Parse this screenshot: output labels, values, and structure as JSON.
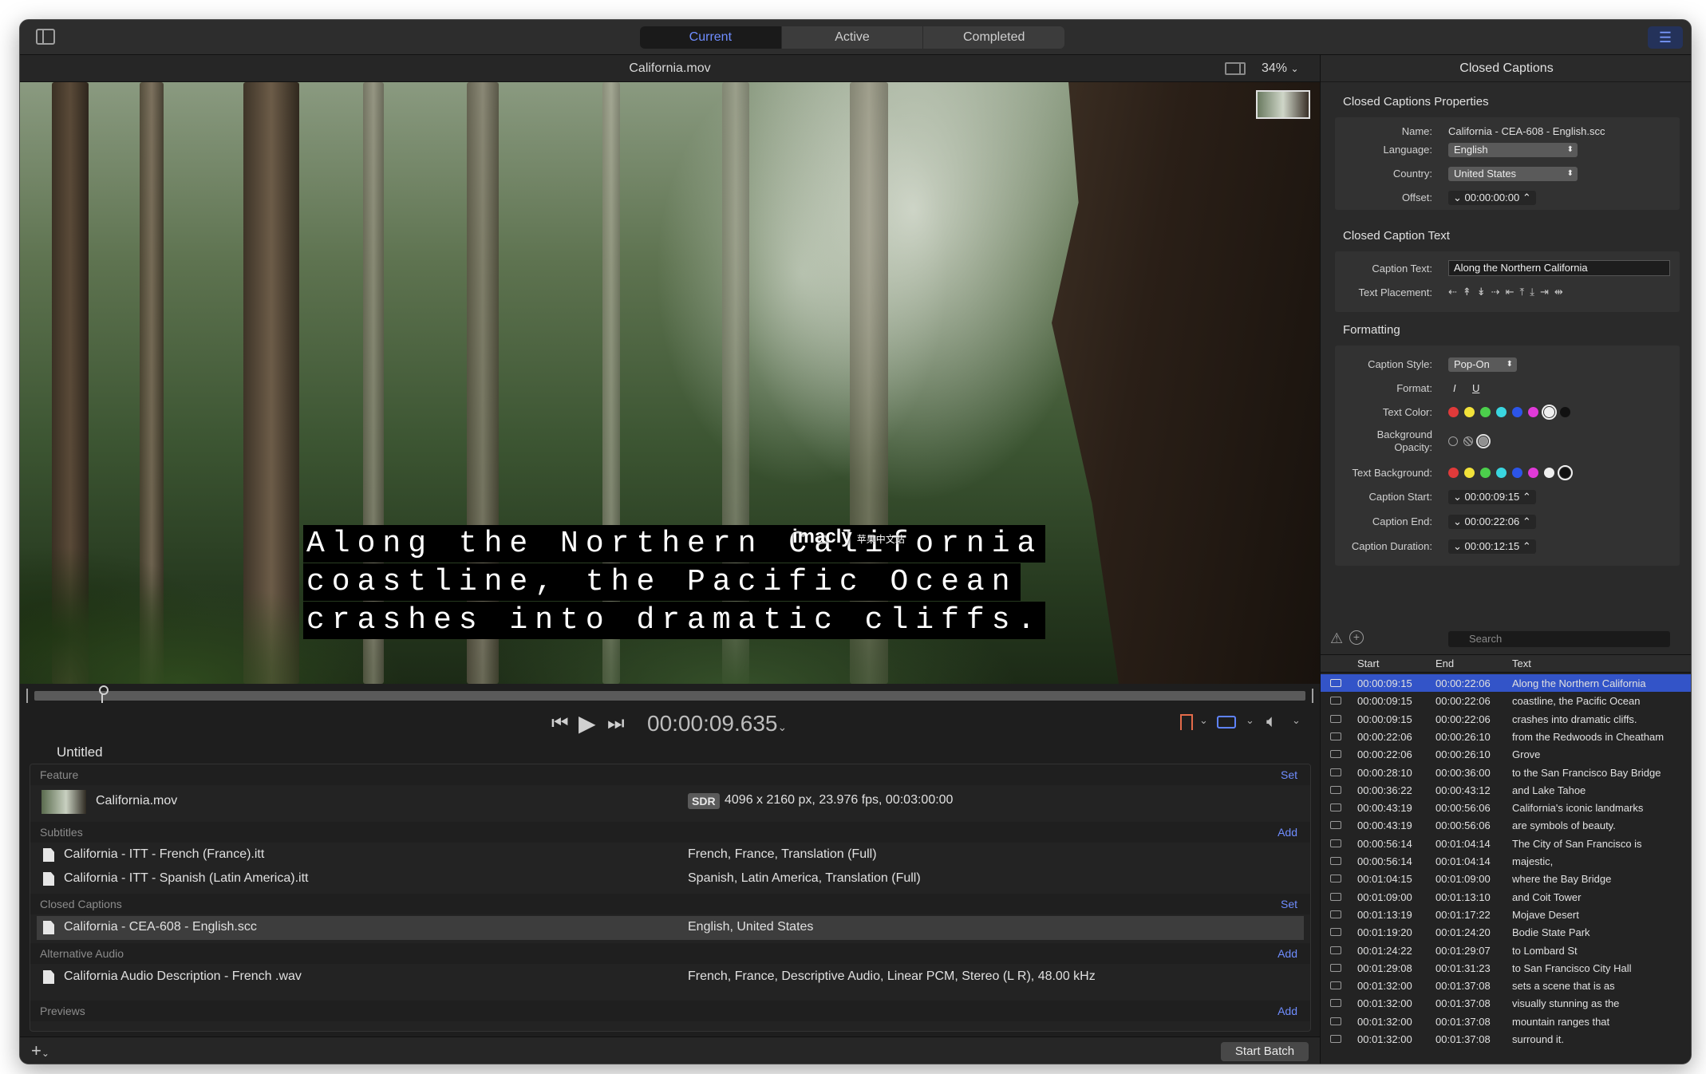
{
  "toolbar": {
    "tabs": [
      "Current",
      "Active",
      "Completed"
    ],
    "selected_tab": "Current",
    "accent": "#6f8dff"
  },
  "viewer": {
    "file_title": "California.mov",
    "zoom": "34%",
    "caption_lines": [
      "Along the Northern California",
      "coastline, the Pacific Ocean",
      "crashes into dramatic cliffs."
    ],
    "watermark": "imacly",
    "watermark_sub": "苹果中文站",
    "timecode": "00:00:09.635",
    "playhead_fraction": 0.053
  },
  "batch": {
    "title": "Untitled",
    "feature": {
      "label": "Feature",
      "action": "Set",
      "file": "California.mov",
      "badge": "SDR",
      "info": "4096 x 2160 px, 23.976 fps, 00:03:00:00"
    },
    "subtitles": {
      "label": "Subtitles",
      "action": "Add",
      "items": [
        {
          "name": "California - ITT - French (France).itt",
          "info": "French, France, Translation (Full)"
        },
        {
          "name": "California - ITT - Spanish (Latin America).itt",
          "info": "Spanish, Latin America, Translation (Full)"
        }
      ]
    },
    "closed_captions": {
      "label": "Closed Captions",
      "action": "Set",
      "items": [
        {
          "name": "California - CEA-608 - English.scc",
          "info": "English, United States"
        }
      ]
    },
    "alt_audio": {
      "label": "Alternative Audio",
      "action": "Add",
      "items": [
        {
          "name": "California Audio Description - French .wav",
          "info": "French, France, Descriptive Audio, Linear PCM, Stereo (L R), 48.00 kHz"
        }
      ]
    },
    "previews": {
      "label": "Previews",
      "action": "Add"
    },
    "start_label": "Start Batch"
  },
  "inspector": {
    "title": "Closed Captions",
    "props_title": "Closed Captions Properties",
    "name_label": "Name:",
    "name_value": "California - CEA-608 - English.scc",
    "language_label": "Language:",
    "language_value": "English",
    "country_label": "Country:",
    "country_value": "United States",
    "offset_label": "Offset:",
    "offset_value": "00:00:00:00",
    "text_title": "Closed Caption Text",
    "caption_text_label": "Caption Text:",
    "caption_text_value": "Along the Northern California",
    "placement_label": "Text Placement:",
    "placement_glyphs": "⇠↟↡⇢⇤⤒⤓⇥⇹",
    "formatting_title": "Formatting",
    "style_label": "Caption Style:",
    "style_value": "Pop-On",
    "format_label": "Format:",
    "format_italic": "I",
    "format_underline": "U",
    "text_color_label": "Text Color:",
    "bg_opacity_label_1": "Background",
    "bg_opacity_label_2": "Opacity:",
    "text_bg_label": "Text Background:",
    "start_label": "Caption Start:",
    "start_value": "00:00:09:15",
    "end_label": "Caption End:",
    "end_value": "00:00:22:06",
    "duration_label": "Caption Duration:",
    "duration_value": "00:00:12:15",
    "colors": [
      "#e03a3a",
      "#f2e23a",
      "#4ccf4c",
      "#3ad6e0",
      "#2c55e8",
      "#e03ad8",
      "#f0f0f0",
      "#111111"
    ]
  },
  "caption_list": {
    "search_placeholder": "Search",
    "headers": {
      "start": "Start",
      "end": "End",
      "text": "Text"
    },
    "rows": [
      {
        "start": "00:00:09:15",
        "end": "00:00:22:06",
        "text": "Along the Northern California"
      },
      {
        "start": "00:00:09:15",
        "end": "00:00:22:06",
        "text": "coastline, the Pacific Ocean"
      },
      {
        "start": "00:00:09:15",
        "end": "00:00:22:06",
        "text": "crashes into dramatic cliffs."
      },
      {
        "start": "00:00:22:06",
        "end": "00:00:26:10",
        "text": "from the Redwoods in Cheatham"
      },
      {
        "start": "00:00:22:06",
        "end": "00:00:26:10",
        "text": "Grove"
      },
      {
        "start": "00:00:28:10",
        "end": "00:00:36:00",
        "text": "to the San Francisco Bay Bridge"
      },
      {
        "start": "00:00:36:22",
        "end": "00:00:43:12",
        "text": "and Lake Tahoe"
      },
      {
        "start": "00:00:43:19",
        "end": "00:00:56:06",
        "text": "California's iconic landmarks"
      },
      {
        "start": "00:00:43:19",
        "end": "00:00:56:06",
        "text": "are symbols of beauty."
      },
      {
        "start": "00:00:56:14",
        "end": "00:01:04:14",
        "text": "The City of San Francisco is"
      },
      {
        "start": "00:00:56:14",
        "end": "00:01:04:14",
        "text": "majestic,"
      },
      {
        "start": "00:01:04:15",
        "end": "00:01:09:00",
        "text": "where the Bay Bridge"
      },
      {
        "start": "00:01:09:00",
        "end": "00:01:13:10",
        "text": "and Coit Tower"
      },
      {
        "start": "00:01:13:19",
        "end": "00:01:17:22",
        "text": "Mojave Desert"
      },
      {
        "start": "00:01:19:20",
        "end": "00:01:24:20",
        "text": "Bodie State Park"
      },
      {
        "start": "00:01:24:22",
        "end": "00:01:29:07",
        "text": "to Lombard St"
      },
      {
        "start": "00:01:29:08",
        "end": "00:01:31:23",
        "text": "to San Francisco City Hall"
      },
      {
        "start": "00:01:32:00",
        "end": "00:01:37:08",
        "text": "sets a scene that is as"
      },
      {
        "start": "00:01:32:00",
        "end": "00:01:37:08",
        "text": "visually stunning as the"
      },
      {
        "start": "00:01:32:00",
        "end": "00:01:37:08",
        "text": "mountain ranges that"
      },
      {
        "start": "00:01:32:00",
        "end": "00:01:37:08",
        "text": "surround it."
      }
    ]
  }
}
